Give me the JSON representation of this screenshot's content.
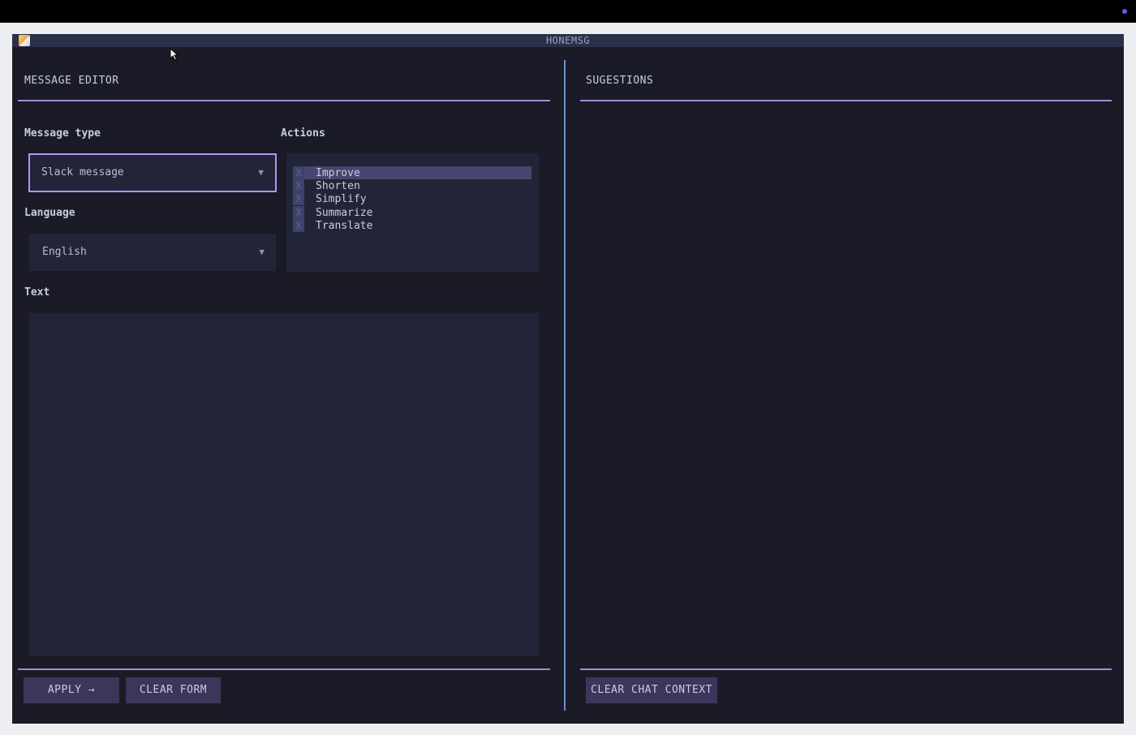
{
  "window": {
    "title": "HONEMSG"
  },
  "editor": {
    "title": "MESSAGE EDITOR",
    "message_type_label": "Message type",
    "message_type_value": "Slack message",
    "language_label": "Language",
    "language_value": "English",
    "actions_label": "Actions",
    "actions": [
      {
        "label": "Improve",
        "check": "X",
        "selected": true
      },
      {
        "label": "Shorten",
        "check": "X",
        "selected": false
      },
      {
        "label": "Simplify",
        "check": "X",
        "selected": false
      },
      {
        "label": "Summarize",
        "check": "X",
        "selected": false
      },
      {
        "label": "Translate",
        "check": "X",
        "selected": false
      }
    ],
    "text_label": "Text",
    "text_value": "",
    "apply_label": "APPLY →",
    "clear_form_label": "CLEAR FORM"
  },
  "suggestions": {
    "title": "SUGESTIONS",
    "clear_chat_label": "CLEAR CHAT CONTEXT"
  },
  "colors": {
    "background": "#1a1b26",
    "accent": "#a48ad8",
    "divider": "#6f8fd8",
    "button": "#3b365a"
  },
  "icons": {
    "dropdown": "triangle-down-icon",
    "app": "notepad-icon",
    "cursor": "mouse-pointer-icon"
  }
}
